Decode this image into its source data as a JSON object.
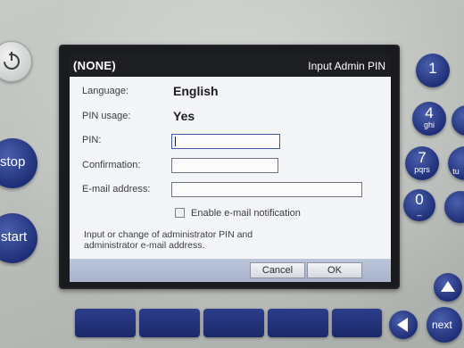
{
  "dialog": {
    "status": "(NONE)",
    "title": "Input Admin PIN",
    "language_label": "Language:",
    "language_value": "English",
    "pin_usage_label": "PIN usage:",
    "pin_usage_value": "Yes",
    "pin_label": "PIN:",
    "pin_value": "",
    "confirmation_label": "Confirmation:",
    "confirmation_value": "",
    "email_label": "E-mail address:",
    "email_value": "",
    "notification_label": "Enable e-mail notification",
    "notification_checked": false,
    "info_line1": "Input or change of administrator PIN and",
    "info_line2": "administrator e-mail address.",
    "cancel_label": "Cancel",
    "ok_label": "OK"
  },
  "device": {
    "stop_label": "stop",
    "start_label": "start",
    "key1_main": "1",
    "key4_main": "4",
    "key4_sub": "ghi",
    "key7_main": "7",
    "key7_sub": "pqrs",
    "key0_main": "0",
    "key0_sub": "_",
    "next_label": "next",
    "partial_key_sub": "tu",
    "accent_blue": "#23347e"
  }
}
